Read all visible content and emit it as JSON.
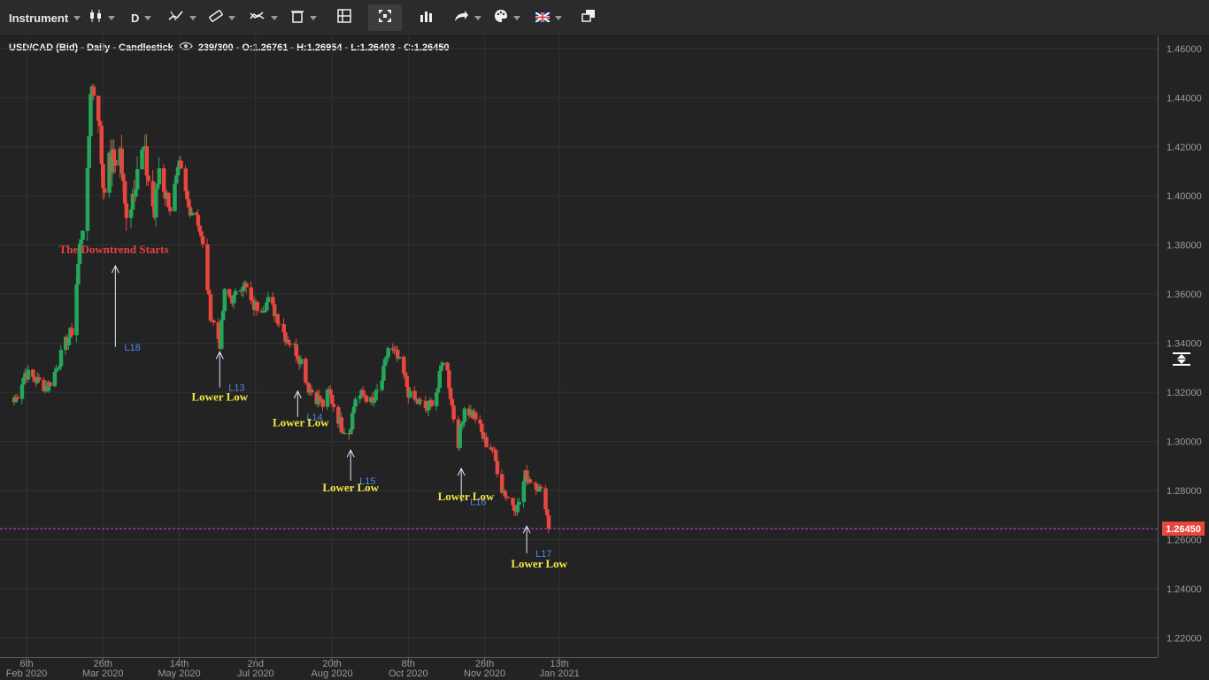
{
  "toolbar": {
    "instrument_label": "Instrument",
    "timeframe_label": "D",
    "flag_icon": "uk-flag-icon"
  },
  "header": {
    "symbol_line": "USD/CAD (Bid) - Daily - Candlestick",
    "count": "239/300",
    "ohlc": "O:1.26761 - H:1.26954 - L:1.26403 - C:1.26450"
  },
  "colors": {
    "background": "#232323",
    "up": "#26a65b",
    "down": "#e8473f",
    "annotation_red": "#e84040",
    "annotation_yellow": "#f5e642",
    "level_blue": "#4f86e8",
    "price_line": "#c24ad1",
    "price_badge": "#e8473f"
  },
  "chart_data": {
    "type": "candlestick",
    "title": "USD/CAD (Bid) - Daily - Candlestick",
    "current_price": 1.2645,
    "current_price_label": "1.26450",
    "ylim": [
      1.214,
      1.468
    ],
    "y_ticks": [
      "1.22000",
      "1.24000",
      "1.26000",
      "1.28000",
      "1.30000",
      "1.32000",
      "1.34000",
      "1.36000",
      "1.38000",
      "1.40000",
      "1.42000",
      "1.44000",
      "1.46000"
    ],
    "x_ticks": [
      {
        "l1": "6th",
        "l2": "Feb 2020"
      },
      {
        "l1": "26th",
        "l2": "Mar 2020"
      },
      {
        "l1": "14th",
        "l2": "May 2020"
      },
      {
        "l1": "2nd",
        "l2": "Jul 2020"
      },
      {
        "l1": "20th",
        "l2": "Aug 2020"
      },
      {
        "l1": "8th",
        "l2": "Oct 2020"
      },
      {
        "l1": "26th",
        "l2": "Nov 2020"
      },
      {
        "l1": "13th",
        "l2": "Jan 2021"
      }
    ],
    "keypoints": [
      [
        "2020-01-29",
        1.316
      ],
      [
        "2020-02-05",
        1.328
      ],
      [
        "2020-02-12",
        1.325
      ],
      [
        "2020-02-19",
        1.322
      ],
      [
        "2020-02-24",
        1.328
      ],
      [
        "2020-03-02",
        1.34
      ],
      [
        "2020-03-06",
        1.345
      ],
      [
        "2020-03-09",
        1.365
      ],
      [
        "2020-03-12",
        1.385
      ],
      [
        "2020-03-16",
        1.405
      ],
      [
        "2020-03-18",
        1.445
      ],
      [
        "2020-03-20",
        1.443
      ],
      [
        "2020-03-23",
        1.435
      ],
      [
        "2020-03-26",
        1.405
      ],
      [
        "2020-03-30",
        1.412
      ],
      [
        "2020-04-02",
        1.415
      ],
      [
        "2020-04-06",
        1.418
      ],
      [
        "2020-04-09",
        1.395
      ],
      [
        "2020-04-13",
        1.398
      ],
      [
        "2020-04-17",
        1.412
      ],
      [
        "2020-04-21",
        1.418
      ],
      [
        "2020-04-28",
        1.392
      ],
      [
        "2020-05-01",
        1.412
      ],
      [
        "2020-05-08",
        1.395
      ],
      [
        "2020-05-14",
        1.412
      ],
      [
        "2020-05-20",
        1.395
      ],
      [
        "2020-05-25",
        1.393
      ],
      [
        "2020-05-29",
        1.379
      ],
      [
        "2020-06-03",
        1.352
      ],
      [
        "2020-06-09",
        1.34
      ],
      [
        "2020-06-12",
        1.36
      ],
      [
        "2020-06-18",
        1.358
      ],
      [
        "2020-06-24",
        1.365
      ],
      [
        "2020-06-30",
        1.355
      ],
      [
        "2020-07-06",
        1.355
      ],
      [
        "2020-07-10",
        1.357
      ],
      [
        "2020-07-15",
        1.352
      ],
      [
        "2020-07-21",
        1.343
      ],
      [
        "2020-07-27",
        1.338
      ],
      [
        "2020-07-31",
        1.333
      ],
      [
        "2020-08-05",
        1.322
      ],
      [
        "2020-08-10",
        1.318
      ],
      [
        "2020-08-14",
        1.315
      ],
      [
        "2020-08-18",
        1.32
      ],
      [
        "2020-08-26",
        1.306
      ],
      [
        "2020-08-31",
        1.304
      ],
      [
        "2020-09-04",
        1.318
      ],
      [
        "2020-09-10",
        1.319
      ],
      [
        "2020-09-15",
        1.315
      ],
      [
        "2020-09-21",
        1.325
      ],
      [
        "2020-09-25",
        1.338
      ],
      [
        "2020-09-30",
        1.335
      ],
      [
        "2020-10-05",
        1.327
      ],
      [
        "2020-10-09",
        1.318
      ],
      [
        "2020-10-14",
        1.316
      ],
      [
        "2020-10-20",
        1.313
      ],
      [
        "2020-10-27",
        1.322
      ],
      [
        "2020-10-30",
        1.334
      ],
      [
        "2020-11-02",
        1.328
      ],
      [
        "2020-11-06",
        1.31
      ],
      [
        "2020-11-09",
        1.3
      ],
      [
        "2020-11-13",
        1.314
      ],
      [
        "2020-11-20",
        1.31
      ],
      [
        "2020-11-26",
        1.3
      ],
      [
        "2020-12-01",
        1.297
      ],
      [
        "2020-12-07",
        1.281
      ],
      [
        "2020-12-11",
        1.277
      ],
      [
        "2020-12-17",
        1.273
      ],
      [
        "2020-12-22",
        1.286
      ],
      [
        "2020-12-29",
        1.283
      ],
      [
        "2021-01-04",
        1.275
      ],
      [
        "2021-01-06",
        1.2645
      ]
    ],
    "annotations": [
      {
        "text": "The Downtrend Starts",
        "date": "2020-04-02",
        "y": 1.3785,
        "color": "red"
      },
      {
        "text": "Lower Low",
        "date": "2020-06-09",
        "y": 1.3185,
        "color": "yellow"
      },
      {
        "text": "Lower Low",
        "date": "2020-07-31",
        "y": 1.308,
        "color": "yellow"
      },
      {
        "text": "Lower Low",
        "date": "2020-09-01",
        "y": 1.2815,
        "color": "yellow"
      },
      {
        "text": "Lower Low",
        "date": "2020-11-14",
        "y": 1.2778,
        "color": "yellow"
      },
      {
        "text": "Lower Low",
        "date": "2020-12-31",
        "y": 1.2505,
        "color": "yellow"
      }
    ],
    "levels": [
      {
        "label": "L18",
        "date": "2020-04-03",
        "y_top": 1.3715,
        "y_bottom": 1.3385
      },
      {
        "label": "L13",
        "date": "2020-06-09",
        "y_top": 1.3365,
        "y_bottom": 1.322
      },
      {
        "label": "L14",
        "date": "2020-07-29",
        "y_top": 1.3205,
        "y_bottom": 1.31
      },
      {
        "label": "L15",
        "date": "2020-09-01",
        "y_top": 1.2965,
        "y_bottom": 1.284
      },
      {
        "label": "L16",
        "date": "2020-11-11",
        "y_top": 1.289,
        "y_bottom": 1.2755
      },
      {
        "label": "L17",
        "date": "2020-12-23",
        "y_top": 1.2655,
        "y_bottom": 1.2545
      }
    ]
  }
}
